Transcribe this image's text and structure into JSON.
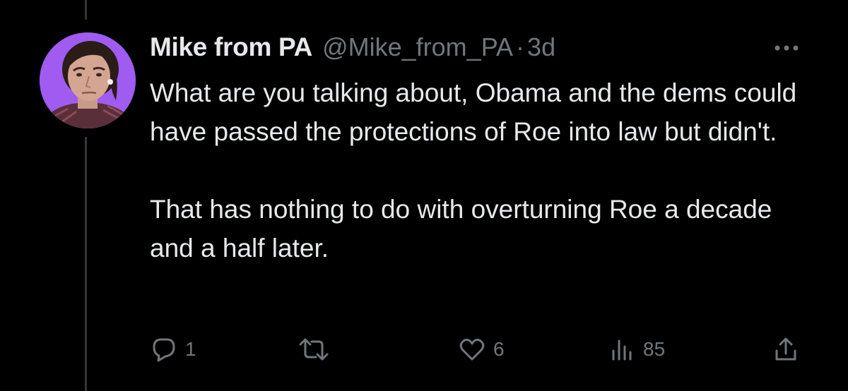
{
  "tweet": {
    "author": {
      "display_name": "Mike from PA",
      "handle": "@Mike_from_PA",
      "avatar": "profile-photo"
    },
    "separator": "·",
    "time_ago": "3d",
    "text_paragraphs": [
      "What are you talking about, Obama and the dems could have passed the protections of Roe into law but didn't.",
      "That has nothing to do with overturning Roe a decade and a half later."
    ],
    "more_icon": "more-horizontal-icon",
    "actions": {
      "reply": {
        "icon": "reply-icon",
        "count": "1"
      },
      "retweet": {
        "icon": "retweet-icon",
        "count": ""
      },
      "like": {
        "icon": "heart-icon",
        "count": "6"
      },
      "views": {
        "icon": "views-bar-icon",
        "count": "85"
      },
      "share": {
        "icon": "share-icon",
        "count": ""
      }
    }
  },
  "colors": {
    "background": "#000000",
    "primary_text": "#e7e9ea",
    "secondary_text": "#71767b",
    "thread_line": "#333639",
    "avatar_bg": "#a05bf0"
  }
}
